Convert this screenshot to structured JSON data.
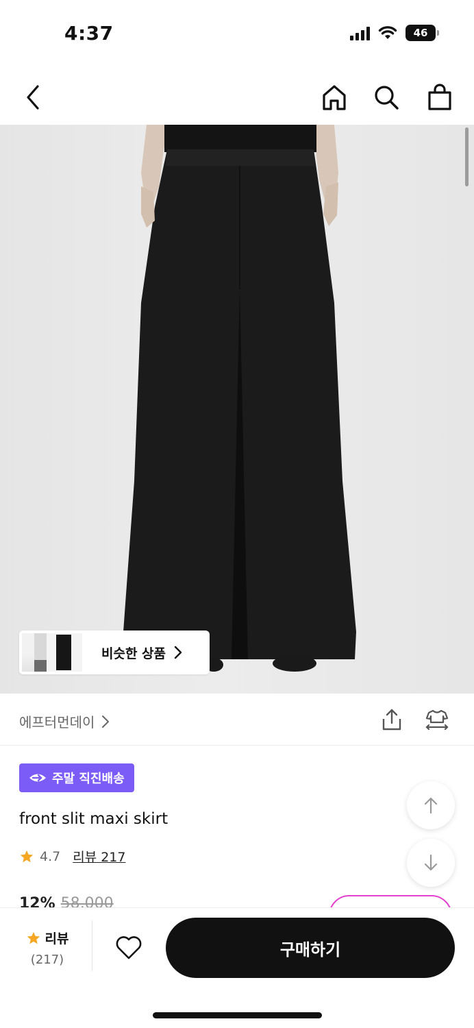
{
  "status_bar": {
    "time": "4:37",
    "battery": "46"
  },
  "nav": {
    "icons": [
      "back-icon",
      "home-icon",
      "search-icon",
      "shopping-bag-icon"
    ]
  },
  "image": {
    "similar_label": "비슷한 상품"
  },
  "brand": {
    "name": "에프터먼데이"
  },
  "product": {
    "delivery_badge": "주말 직진배송",
    "title": "front slit maxi skirt",
    "rating": "4.7",
    "review_link": "리뷰 217",
    "discount": "12%",
    "original_price": "58,000"
  },
  "bottom_bar": {
    "review_label": "리뷰",
    "review_count": "(217)",
    "buy_label": "구매하기"
  },
  "colors": {
    "badge": "#7c5cf6",
    "star": "#f5a623",
    "buy_button": "#111111",
    "coupon_border": "#e53fd0"
  }
}
